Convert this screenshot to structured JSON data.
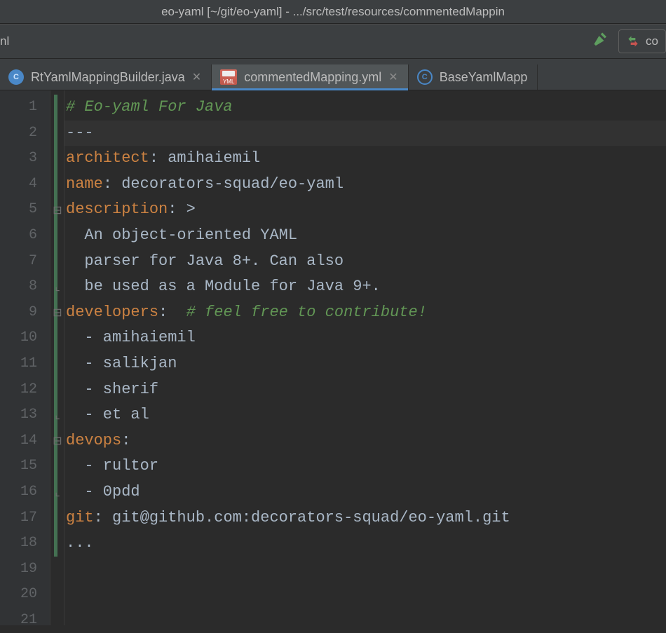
{
  "window": {
    "title": "eo-yaml [~/git/eo-yaml] - .../src/test/resources/commentedMappin"
  },
  "toolbar": {
    "breadcrumb_fragment": "nl",
    "config_label": "co"
  },
  "tabs": [
    {
      "label": "RtYamlMappingBuilder.java",
      "icon": "java-solid",
      "active": false,
      "closable": true
    },
    {
      "label": "commentedMapping.yml",
      "icon": "yml",
      "active": true,
      "closable": true
    },
    {
      "label": "BaseYamlMapp",
      "icon": "java-ring",
      "active": false,
      "closable": false
    }
  ],
  "gutter": {
    "from": 1,
    "to": 21
  },
  "code": {
    "lines": [
      {
        "t": "comment",
        "text": "# Eo-yaml For Java"
      },
      {
        "t": "text",
        "text": "---"
      },
      {
        "t": "kv",
        "key": "architect",
        "value": " amihaiemil"
      },
      {
        "t": "kv",
        "key": "name",
        "value": " decorators-squad/eo-yaml"
      },
      {
        "t": "kv",
        "key": "description",
        "value": " >"
      },
      {
        "t": "text",
        "text": "  An object-oriented YAML"
      },
      {
        "t": "text",
        "text": "  parser for Java 8+. Can also"
      },
      {
        "t": "text",
        "text": "  be used as a Module for Java 9+."
      },
      {
        "t": "kvcom",
        "key": "developers",
        "value": "  ",
        "comment": "# feel free to contribute!"
      },
      {
        "t": "text",
        "text": "  - amihaiemil"
      },
      {
        "t": "text",
        "text": "  - salikjan"
      },
      {
        "t": "text",
        "text": "  - sherif"
      },
      {
        "t": "text",
        "text": "  - et al"
      },
      {
        "t": "kv",
        "key": "devops",
        "value": ""
      },
      {
        "t": "text",
        "text": "  - rultor"
      },
      {
        "t": "text",
        "text": "  - 0pdd"
      },
      {
        "t": "kv",
        "key": "git",
        "value": " git@github.com:decorators-squad/eo-yaml.git"
      },
      {
        "t": "text",
        "text": "..."
      },
      {
        "t": "text",
        "text": ""
      },
      {
        "t": "text",
        "text": ""
      },
      {
        "t": "text",
        "text": ""
      }
    ],
    "caret_line": 2,
    "change_bar_lines": 18,
    "fold_markers": [
      {
        "line": 5,
        "glyph": "⊟"
      },
      {
        "line": 8,
        "glyph": "⌞"
      },
      {
        "line": 9,
        "glyph": "⊟"
      },
      {
        "line": 13,
        "glyph": "⌞"
      },
      {
        "line": 14,
        "glyph": "⊟"
      },
      {
        "line": 16,
        "glyph": "⌞"
      }
    ]
  }
}
